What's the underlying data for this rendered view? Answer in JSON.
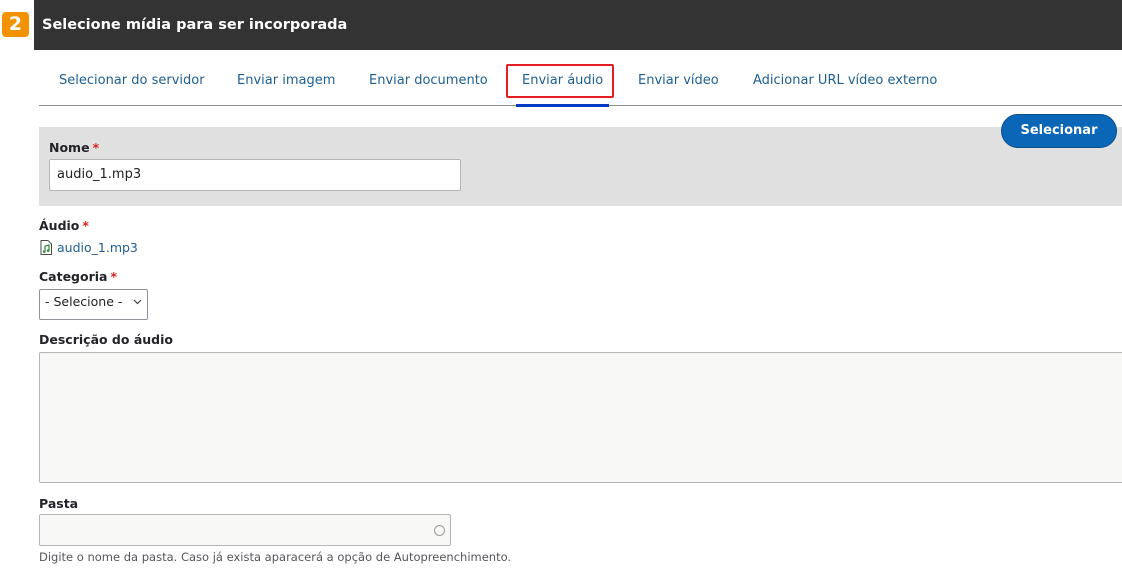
{
  "step_badge": "2",
  "dialog": {
    "title": "Selecione mídia para ser incorporada"
  },
  "tabs": [
    {
      "label": "Selecionar do servidor"
    },
    {
      "label": "Enviar imagem"
    },
    {
      "label": "Enviar documento"
    },
    {
      "label": "Enviar áudio",
      "active": true
    },
    {
      "label": "Enviar vídeo"
    },
    {
      "label": "Adicionar URL vídeo externo"
    }
  ],
  "select_button": "Selecionar",
  "form": {
    "name": {
      "label": "Nome",
      "required_mark": "*",
      "value": "audio_1.mp3"
    },
    "audio": {
      "label": "Áudio",
      "required_mark": "*",
      "file": "audio_1.mp3",
      "icon": "audio-file-icon"
    },
    "category": {
      "label": "Categoria",
      "required_mark": "*",
      "selected": "- Selecione -"
    },
    "description": {
      "label": "Descrição do áudio",
      "value": ""
    },
    "folder": {
      "label": "Pasta",
      "value": "",
      "help": "Digite o nome da pasta. Caso já exista aparacerá a opção de Autopreenchimento."
    }
  },
  "colors": {
    "header_bg": "#333333",
    "badge": "#f39200",
    "link": "#1d5f94",
    "primary_button": "#0a67b7",
    "tab_highlight": "#e31e24",
    "active_tab_underline": "#003cc5",
    "required": "#dc2323"
  }
}
